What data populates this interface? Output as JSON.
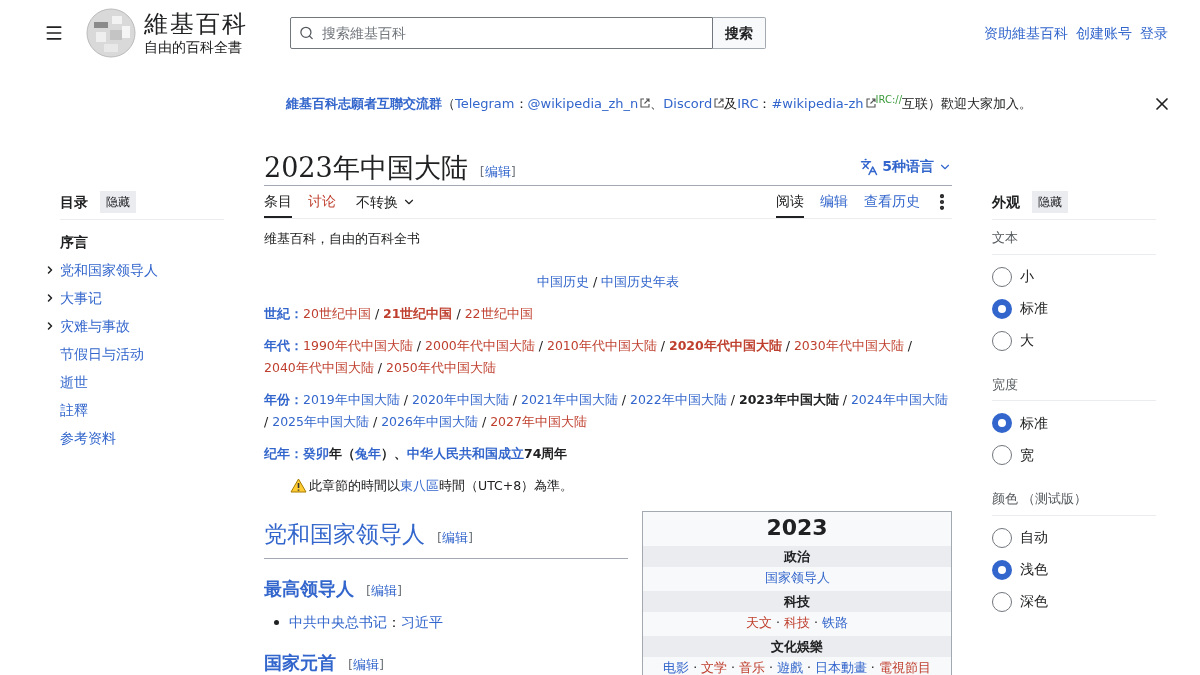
{
  "header": {
    "logo": {
      "wordmark": "維基百科",
      "tagline": "自由的百科全書"
    },
    "search": {
      "placeholder": "搜索維基百科",
      "button": "搜索"
    },
    "user_links": [
      "资助維基百科",
      "创建账号",
      "登录"
    ]
  },
  "banner": {
    "runs": [
      {
        "text": "維基百科志願者互聯交流群",
        "kind": "bold-link"
      },
      {
        "text": "（",
        "kind": "plain"
      },
      {
        "text": "Telegram",
        "kind": "link"
      },
      {
        "text": "：",
        "kind": "plain"
      },
      {
        "text": "@wikipedia_zh_n",
        "kind": "ext"
      },
      {
        "text": "、",
        "kind": "plain"
      },
      {
        "text": "Discord",
        "kind": "ext"
      },
      {
        "text": "及",
        "kind": "plain"
      },
      {
        "text": "IRC",
        "kind": "link"
      },
      {
        "text": "：",
        "kind": "plain"
      },
      {
        "text": "#wikipedia-zh",
        "kind": "ext"
      },
      {
        "text": "IRC://",
        "kind": "sup"
      },
      {
        "text": "互联）歡迎大家加入。",
        "kind": "plain"
      }
    ]
  },
  "title": "2023年中国大陆",
  "title_edit": [
    "[",
    "编辑",
    "]"
  ],
  "languages": "5种语言",
  "left_tabs": [
    {
      "label": "条目",
      "selected": true,
      "kind": "normal"
    },
    {
      "label": "讨论",
      "selected": false,
      "kind": "new"
    }
  ],
  "variant": "不转换",
  "right_tabs": [
    {
      "label": "阅读",
      "selected": true
    },
    {
      "label": "编辑",
      "selected": false
    },
    {
      "label": "查看历史",
      "selected": false
    }
  ],
  "tagline": "维基百科，自由的百科全书",
  "navbox": {
    "top": [
      {
        "text": "中国历史",
        "kind": "link"
      },
      {
        "text": " / ",
        "kind": "plain"
      },
      {
        "text": "中国历史年表",
        "kind": "link"
      }
    ],
    "rows": [
      {
        "label": "世紀：",
        "runs": [
          {
            "text": "20世纪中国",
            "kind": "new"
          },
          {
            "text": " / ",
            "kind": "plain"
          },
          {
            "text": "21世纪中国",
            "kind": "new-bold"
          },
          {
            "text": " / ",
            "kind": "plain"
          },
          {
            "text": "22世纪中国",
            "kind": "new"
          }
        ]
      },
      {
        "label": "年代：",
        "runs": [
          {
            "text": "1990年代中国大陆",
            "kind": "new"
          },
          {
            "text": " / ",
            "kind": "plain"
          },
          {
            "text": "2000年代中国大陆",
            "kind": "new"
          },
          {
            "text": " / ",
            "kind": "plain"
          },
          {
            "text": "2010年代中国大陆",
            "kind": "new"
          },
          {
            "text": " / ",
            "kind": "plain"
          },
          {
            "text": "2020年代中国大陆",
            "kind": "new-bold"
          },
          {
            "text": " / ",
            "kind": "plain"
          },
          {
            "text": "2030年代中国大陆",
            "kind": "new"
          },
          {
            "text": " / ",
            "kind": "plain"
          },
          {
            "text": "2040年代中国大陆",
            "kind": "new"
          },
          {
            "text": " / ",
            "kind": "plain"
          },
          {
            "text": "2050年代中国大陆",
            "kind": "new"
          }
        ]
      },
      {
        "label": "年份：",
        "runs": [
          {
            "text": "2019年中国大陆",
            "kind": "link"
          },
          {
            "text": " / ",
            "kind": "plain"
          },
          {
            "text": "2020年中国大陆",
            "kind": "link"
          },
          {
            "text": " / ",
            "kind": "plain"
          },
          {
            "text": "2021年中国大陆",
            "kind": "link"
          },
          {
            "text": " / ",
            "kind": "plain"
          },
          {
            "text": "2022年中国大陆",
            "kind": "link"
          },
          {
            "text": " / ",
            "kind": "plain"
          },
          {
            "text": "2023年中国大陆",
            "kind": "bold"
          },
          {
            "text": " / ",
            "kind": "plain"
          },
          {
            "text": "2024年中国大陆",
            "kind": "link"
          },
          {
            "text": " / ",
            "kind": "plain"
          },
          {
            "text": "2025年中国大陆",
            "kind": "link"
          },
          {
            "text": " / ",
            "kind": "plain"
          },
          {
            "text": "2026年中国大陆",
            "kind": "link"
          },
          {
            "text": " / ",
            "kind": "plain"
          },
          {
            "text": "2027年中国大陆",
            "kind": "new"
          }
        ]
      },
      {
        "label": "纪年：",
        "runs": [
          {
            "text": "癸卯",
            "kind": "bold-link"
          },
          {
            "text": "年（",
            "kind": "bold"
          },
          {
            "text": "兔年",
            "kind": "bold-link"
          },
          {
            "text": "）、",
            "kind": "bold"
          },
          {
            "text": "中华人民共和国成立",
            "kind": "bold-link"
          },
          {
            "text": "74周年",
            "kind": "bold"
          }
        ]
      }
    ]
  },
  "notice": [
    {
      "text": "此章節的時間以",
      "kind": "plain"
    },
    {
      "text": "東八區",
      "kind": "link"
    },
    {
      "text": "時間（UTC+8）為準。",
      "kind": "plain"
    }
  ],
  "sections": [
    {
      "kind": "h2",
      "title": "党和国家领导人",
      "edit": [
        "[",
        "编辑",
        "]"
      ]
    },
    {
      "kind": "h3",
      "title": "最高领导人",
      "edit": [
        "[",
        "编辑",
        "]"
      ]
    },
    {
      "kind": "bullet",
      "runs": [
        {
          "text": "中共中央总书记",
          "kind": "link"
        },
        {
          "text": "：",
          "kind": "plain"
        },
        {
          "text": "习近平",
          "kind": "link"
        }
      ]
    },
    {
      "kind": "h3",
      "title": "国家元首",
      "edit": [
        "[",
        "编辑",
        "]"
      ]
    }
  ],
  "infobox": {
    "title": "2023",
    "groups": [
      {
        "heading": "政治",
        "runs": [
          {
            "text": "国家领导人",
            "kind": "link"
          }
        ]
      },
      {
        "heading": "科技",
        "runs": [
          {
            "text": "天文",
            "kind": "new"
          },
          {
            "text": " · ",
            "kind": "plain"
          },
          {
            "text": "科技",
            "kind": "new"
          },
          {
            "text": " · ",
            "kind": "plain"
          },
          {
            "text": "铁路",
            "kind": "link"
          }
        ]
      },
      {
        "heading": "文化娛樂",
        "runs": [
          {
            "text": "电影",
            "kind": "link"
          },
          {
            "text": " · ",
            "kind": "plain"
          },
          {
            "text": "文学",
            "kind": "new"
          },
          {
            "text": " · ",
            "kind": "plain"
          },
          {
            "text": "音乐",
            "kind": "new"
          },
          {
            "text": " · ",
            "kind": "plain"
          },
          {
            "text": "遊戲",
            "kind": "link"
          },
          {
            "text": " · ",
            "kind": "plain"
          },
          {
            "text": "日本動畫",
            "kind": "link"
          },
          {
            "text": " · ",
            "kind": "plain"
          },
          {
            "text": "電視節目",
            "kind": "new"
          }
        ]
      }
    ]
  },
  "toc": {
    "title": "目录",
    "hide": "隐藏",
    "items": [
      {
        "label": "序言",
        "selected": true,
        "kind": "leaf"
      },
      {
        "label": "党和国家领导人",
        "selected": false,
        "kind": "group"
      },
      {
        "label": "大事记",
        "selected": false,
        "kind": "group"
      },
      {
        "label": "灾难与事故",
        "selected": false,
        "kind": "group"
      },
      {
        "label": "节假日与活动",
        "selected": false,
        "kind": "leaf"
      },
      {
        "label": "逝世",
        "selected": false,
        "kind": "leaf"
      },
      {
        "label": "註釋",
        "selected": false,
        "kind": "leaf"
      },
      {
        "label": "参考资料",
        "selected": false,
        "kind": "leaf"
      }
    ]
  },
  "appearance": {
    "title": "外观",
    "hide": "隐藏",
    "groups": [
      {
        "label": "文本",
        "options": [
          {
            "label": "小",
            "selected": false
          },
          {
            "label": "标准",
            "selected": true
          },
          {
            "label": "大",
            "selected": false
          }
        ]
      },
      {
        "label": "宽度",
        "options": [
          {
            "label": "标准",
            "selected": true
          },
          {
            "label": "宽",
            "selected": false
          }
        ]
      },
      {
        "label": "颜色 （测试版）",
        "options": [
          {
            "label": "自动",
            "selected": false
          },
          {
            "label": "浅色",
            "selected": true
          },
          {
            "label": "深色",
            "selected": false
          }
        ]
      }
    ]
  }
}
